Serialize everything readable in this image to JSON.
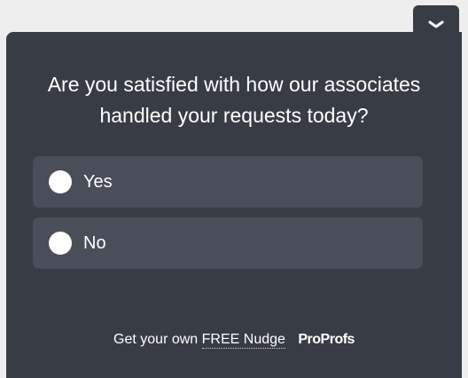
{
  "widget": {
    "collapse_icon": "chevron-down-icon",
    "question": "Are you satisfied with how our associates handled your requests today?",
    "options": [
      {
        "label": "Yes"
      },
      {
        "label": "No"
      }
    ],
    "footer": {
      "prefix": "Get your own",
      "link_text": "FREE Nudge",
      "brand": "ProProfs"
    },
    "colors": {
      "panel": "#383c45",
      "option": "#4a4e59",
      "text": "#ffffff"
    }
  }
}
